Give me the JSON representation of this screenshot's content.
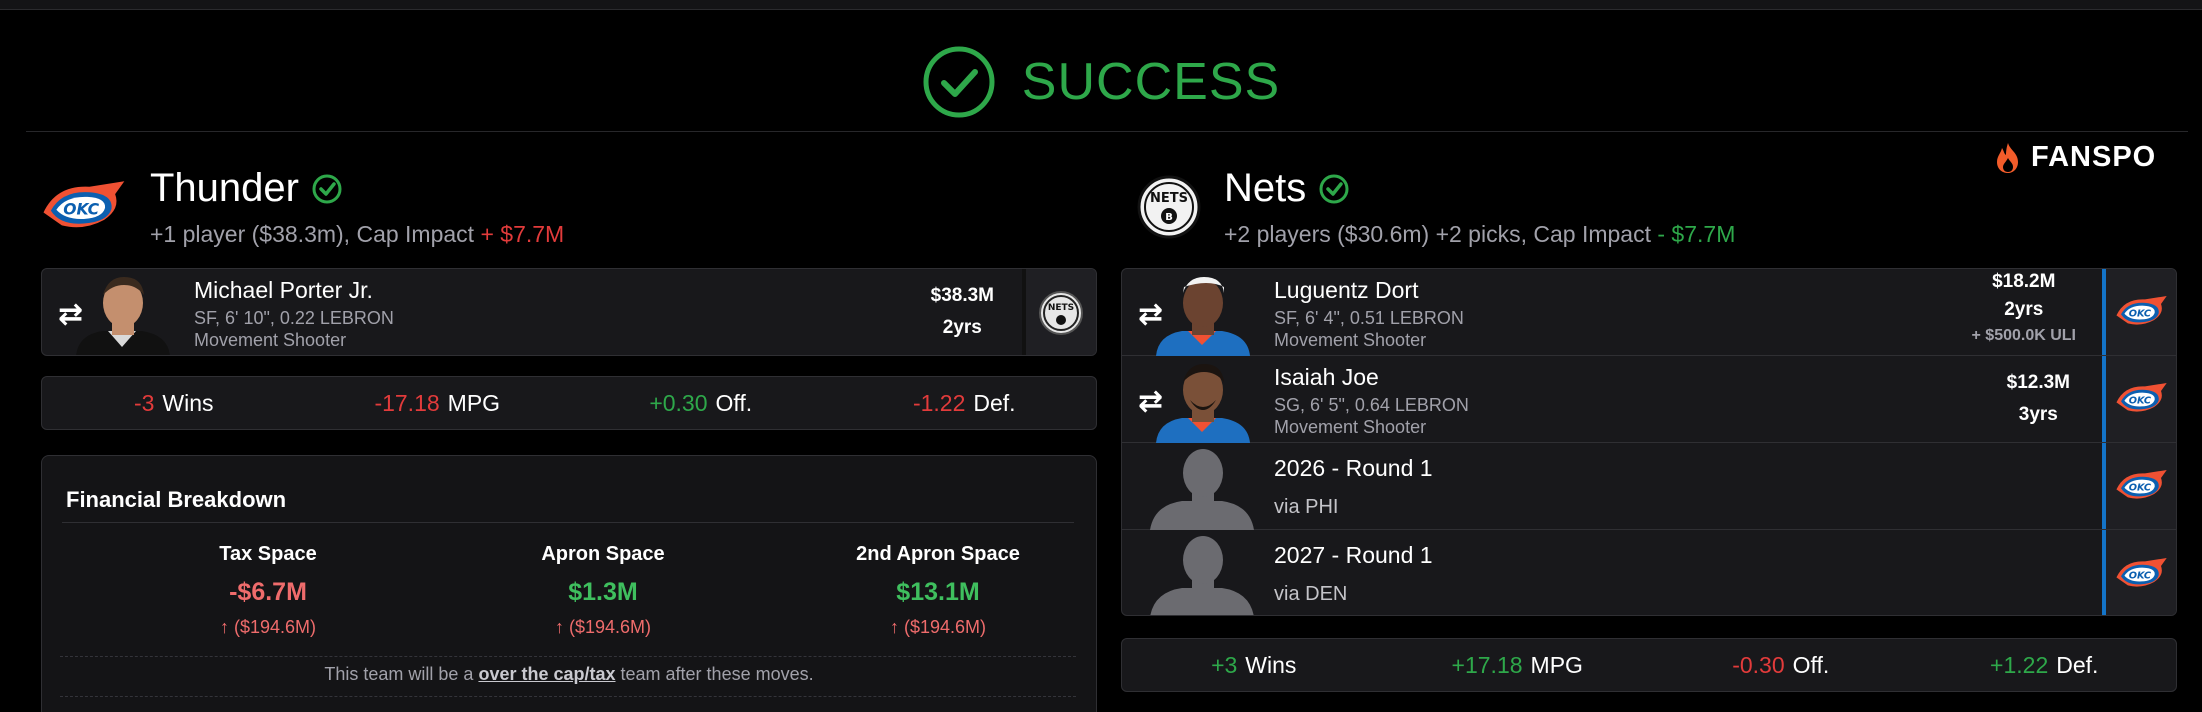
{
  "status": {
    "label": "SUCCESS",
    "color": "#2ea84a"
  },
  "brand": {
    "name": "FANSPO",
    "icon": "flame-icon"
  },
  "teams": [
    {
      "name": "Thunder",
      "logo": "okc-thunder-logo",
      "verified": true,
      "summary": "+1 player ($38.3m), Cap Impact ",
      "cap_impact": "+ $7.7M",
      "players": [
        {
          "name": "Michael Porter Jr.",
          "meta": "SF, 6' 10\", 0.22 LEBRON",
          "role": "Movement Shooter",
          "salary": "$38.3M",
          "years": "2yrs",
          "destination": "brooklyn-nets-logo"
        }
      ],
      "stats": [
        {
          "value": "-3",
          "label": "Wins",
          "color": "#e23b3b"
        },
        {
          "value": "-17.18",
          "label": "MPG",
          "color": "#e23b3b"
        },
        {
          "value": "+0.30",
          "label": "Off.",
          "color": "#2ea84a"
        },
        {
          "value": "-1.22",
          "label": "Def.",
          "color": "#e23b3b"
        }
      ],
      "financial": {
        "title": "Financial Breakdown",
        "columns": [
          {
            "label": "Tax Space",
            "value": "-$6.7M",
            "sub": "($194.6M)",
            "color": "#ef6c6c"
          },
          {
            "label": "Apron Space",
            "value": "$1.3M",
            "sub": "($194.6M)",
            "color": "#3fbf5e"
          },
          {
            "label": "2nd Apron Space",
            "value": "$13.1M",
            "sub": "($194.6M)",
            "color": "#3fbf5e"
          }
        ],
        "note_prefix": "This team will be a ",
        "note_link": "over the cap/tax",
        "note_suffix": " team after these moves."
      }
    },
    {
      "name": "Nets",
      "logo": "brooklyn-nets-logo",
      "verified": true,
      "summary": "+2 players ($30.6m) +2 picks, Cap Impact ",
      "cap_impact": "- $7.7M",
      "players": [
        {
          "name": "Luguentz Dort",
          "meta": "SF, 6' 4\", 0.51 LEBRON",
          "role": "Movement Shooter",
          "salary": "$18.2M",
          "years": "2yrs",
          "extra": "+ $500.0K ULI",
          "destination": "okc-thunder-logo"
        },
        {
          "name": "Isaiah Joe",
          "meta": "SG, 6' 5\", 0.64 LEBRON",
          "role": "Movement Shooter",
          "salary": "$12.3M",
          "years": "3yrs",
          "destination": "okc-thunder-logo"
        }
      ],
      "picks": [
        {
          "name": "2026 - Round 1",
          "via": "via PHI",
          "destination": "okc-thunder-logo"
        },
        {
          "name": "2027 - Round 1",
          "via": "via DEN",
          "destination": "okc-thunder-logo"
        }
      ],
      "stats": [
        {
          "value": "+3",
          "label": "Wins",
          "color": "#2ea84a"
        },
        {
          "value": "+17.18",
          "label": "MPG",
          "color": "#2ea84a"
        },
        {
          "value": "-0.30",
          "label": "Off.",
          "color": "#e23b3b"
        },
        {
          "value": "+1.22",
          "label": "Def.",
          "color": "#2ea84a"
        }
      ]
    }
  ]
}
